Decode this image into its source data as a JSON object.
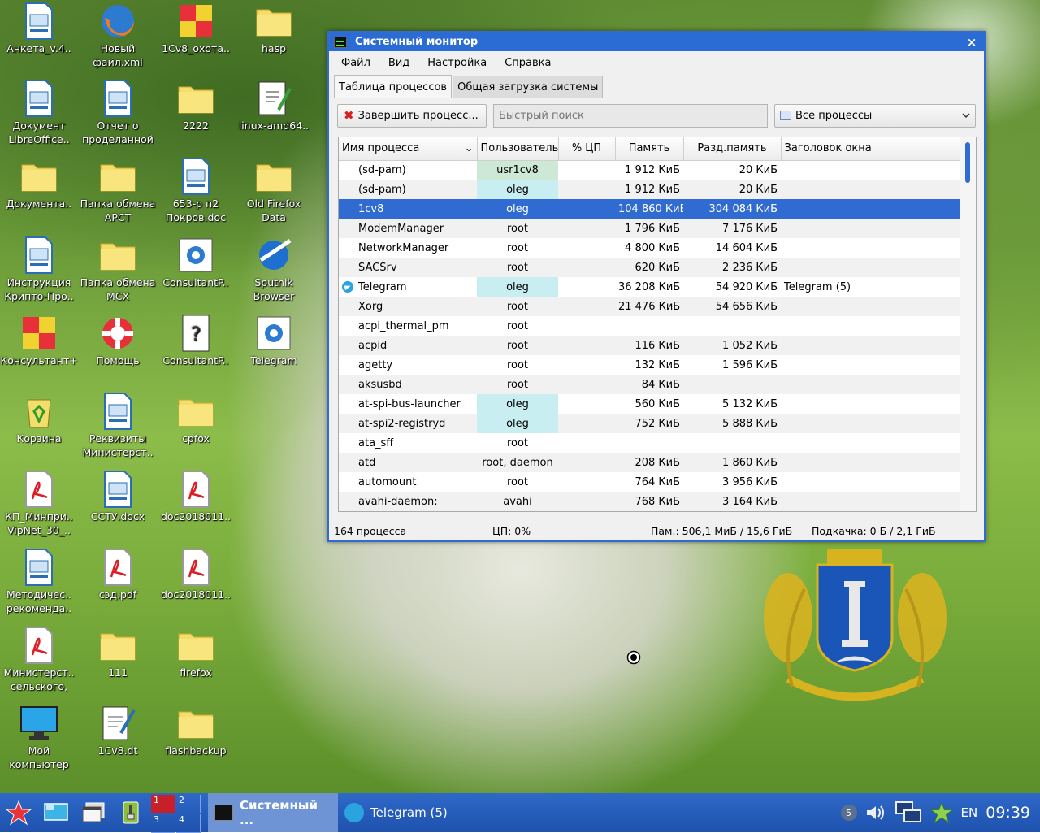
{
  "desktop": {
    "icons": [
      {
        "label": "Анкета_v.4..",
        "type": "doc"
      },
      {
        "label": "Новый\nфайл.xml",
        "type": "firefox"
      },
      {
        "label": "1Cv8_охота..",
        "type": "1c"
      },
      {
        "label": "hasp",
        "type": "folder"
      },
      {
        "label": "Документ\nLibreOffice..",
        "type": "doc"
      },
      {
        "label": "Отчет о\nпроделанной",
        "type": "doc"
      },
      {
        "label": "2222",
        "type": "folder"
      },
      {
        "label": "linux-amd64..",
        "type": "script"
      },
      {
        "label": "Документа..",
        "type": "folder"
      },
      {
        "label": "Папка обмена\nАРСТ",
        "type": "folder"
      },
      {
        "label": "653-р п2\nПокров.doc",
        "type": "doc"
      },
      {
        "label": "Old Firefox\nData",
        "type": "folder"
      },
      {
        "label": "Инструкция\nКрипто-Про..",
        "type": "doc"
      },
      {
        "label": "Папка обмена\nМСХ",
        "type": "folder"
      },
      {
        "label": "ConsultantP..",
        "type": "gear"
      },
      {
        "label": "Sputnik\nBrowser",
        "type": "sputnik"
      },
      {
        "label": "Консультант+",
        "type": "1c"
      },
      {
        "label": "Помощь",
        "type": "help"
      },
      {
        "label": "ConsultantP..",
        "type": "question"
      },
      {
        "label": "Telegram",
        "type": "gear"
      },
      {
        "label": "Корзина",
        "type": "trash"
      },
      {
        "label": "Реквизиты\nМинистерст..",
        "type": "doc"
      },
      {
        "label": "cpfox",
        "type": "folder"
      },
      {
        "label": "КП_Минпри..\nVipNet_30_..",
        "type": "pdf"
      },
      {
        "label": "ССТУ.docx",
        "type": "doc"
      },
      {
        "label": "doc2018011..",
        "type": "pdf"
      },
      {
        "label": "Методичес..\nрекоменда..",
        "type": "doc"
      },
      {
        "label": "сэд.pdf",
        "type": "pdf"
      },
      {
        "label": "doc2018011..",
        "type": "pdf"
      },
      {
        "label": "Министерст..\nсельского,",
        "type": "pdf"
      },
      {
        "label": "111",
        "type": "folder"
      },
      {
        "label": "firefox",
        "type": "folder"
      },
      {
        "label": "Мой\nкомпьютер",
        "type": "computer"
      },
      {
        "label": "1Cv8.dt",
        "type": "edit"
      },
      {
        "label": "flashbackup",
        "type": "folder"
      }
    ]
  },
  "window": {
    "title": "Системный монитор",
    "close": "×",
    "menu": [
      "Файл",
      "Вид",
      "Настройка",
      "Справка"
    ],
    "tabs": [
      "Таблица процессов",
      "Общая загрузка системы"
    ],
    "toolbar": {
      "kill_label": "Завершить процесс...",
      "search_placeholder": "Быстрый поиск",
      "filter_value": "Все процессы"
    },
    "columns": [
      "Имя процесса",
      "Пользователь",
      "% ЦП",
      "Память",
      "Разд.память",
      "Заголовок окна"
    ],
    "rows": [
      {
        "name": "(sd-pam)",
        "user": "usr1cv8",
        "cpu": "",
        "mem": "1 912 КиБ",
        "shared": "20 КиБ",
        "title": ""
      },
      {
        "name": "(sd-pam)",
        "user": "oleg",
        "cpu": "",
        "mem": "1 912 КиБ",
        "shared": "20 КиБ",
        "title": ""
      },
      {
        "name": "1cv8",
        "user": "oleg",
        "cpu": "",
        "mem": "104 860 КиБ",
        "shared": "304 084 КиБ",
        "title": ""
      },
      {
        "name": "ModemManager",
        "user": "root",
        "cpu": "",
        "mem": "1 796 КиБ",
        "shared": "7 176 КиБ",
        "title": ""
      },
      {
        "name": "NetworkManager",
        "user": "root",
        "cpu": "",
        "mem": "4 800 КиБ",
        "shared": "14 604 КиБ",
        "title": ""
      },
      {
        "name": "SACSrv",
        "user": "root",
        "cpu": "",
        "mem": "620 КиБ",
        "shared": "2 236 КиБ",
        "title": ""
      },
      {
        "name": "Telegram",
        "user": "oleg",
        "cpu": "",
        "mem": "36 208 КиБ",
        "shared": "54 920 КиБ",
        "title": "Telegram (5)"
      },
      {
        "name": "Xorg",
        "user": "root",
        "cpu": "",
        "mem": "21 476 КиБ",
        "shared": "54 656 КиБ",
        "title": ""
      },
      {
        "name": "acpi_thermal_pm",
        "user": "root",
        "cpu": "",
        "mem": "",
        "shared": "",
        "title": ""
      },
      {
        "name": "acpid",
        "user": "root",
        "cpu": "",
        "mem": "116 КиБ",
        "shared": "1 052 КиБ",
        "title": ""
      },
      {
        "name": "agetty",
        "user": "root",
        "cpu": "",
        "mem": "132 КиБ",
        "shared": "1 596 КиБ",
        "title": ""
      },
      {
        "name": "aksusbd",
        "user": "root",
        "cpu": "",
        "mem": "84 КиБ",
        "shared": "",
        "title": ""
      },
      {
        "name": "at-spi-bus-launcher",
        "user": "oleg",
        "cpu": "",
        "mem": "560 КиБ",
        "shared": "5 132 КиБ",
        "title": ""
      },
      {
        "name": "at-spi2-registryd",
        "user": "oleg",
        "cpu": "",
        "mem": "752 КиБ",
        "shared": "5 888 КиБ",
        "title": ""
      },
      {
        "name": "ata_sff",
        "user": "root",
        "cpu": "",
        "mem": "",
        "shared": "",
        "title": ""
      },
      {
        "name": "atd",
        "user": "root, daemon",
        "cpu": "",
        "mem": "208 КиБ",
        "shared": "1 860 КиБ",
        "title": ""
      },
      {
        "name": "automount",
        "user": "root",
        "cpu": "",
        "mem": "764 КиБ",
        "shared": "3 956 КиБ",
        "title": ""
      },
      {
        "name": "avahi-daemon:",
        "user": "avahi",
        "cpu": "",
        "mem": "768 КиБ",
        "shared": "3 164 КиБ",
        "title": ""
      }
    ],
    "selected_row": "1cv8",
    "status": {
      "processes": "164 процесса",
      "cpu": "ЦП: 0%",
      "memory": "Пам.: 506,1 МиБ / 15,6 ГиБ",
      "swap": "Подкачка: 0 Б / 2,1 ГиБ"
    }
  },
  "taskbar": {
    "pager": [
      "1",
      "2",
      "3",
      "4"
    ],
    "tasks": [
      {
        "label": "Системный ...",
        "active": true
      },
      {
        "label": "Telegram (5)",
        "active": false
      }
    ],
    "tray_badge": "5",
    "language": "EN",
    "clock": "09:39"
  },
  "colors": {
    "accent": "#2f6bd0",
    "taskbar": "#1e52ae",
    "user_highlight": "#c9eef2"
  }
}
